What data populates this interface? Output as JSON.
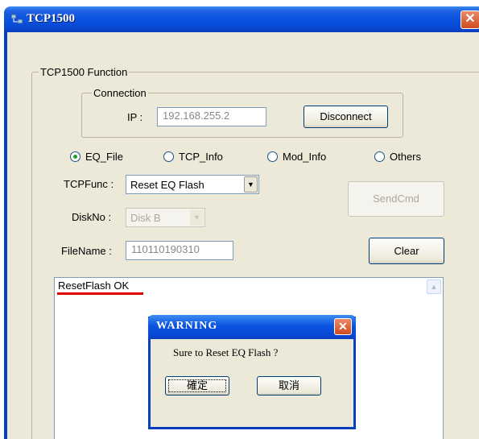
{
  "window": {
    "title": "TCP1500"
  },
  "function_group": {
    "label": "TCP1500 Function"
  },
  "connection": {
    "label": "Connection",
    "ip_label": "IP :",
    "ip_value": "192.168.255.2",
    "disconnect_label": "Disconnect"
  },
  "radios": [
    {
      "label": "EQ_File",
      "selected": true
    },
    {
      "label": "TCP_Info",
      "selected": false
    },
    {
      "label": "Mod_Info",
      "selected": false
    },
    {
      "label": "Others",
      "selected": false
    }
  ],
  "tcpfunc": {
    "label": "TCPFunc :",
    "value": "Reset EQ Flash"
  },
  "sendcmd_label": "SendCmd",
  "diskno": {
    "label": "DiskNo :",
    "value": "Disk B"
  },
  "filename": {
    "label": "FileName :",
    "value": "110110190310"
  },
  "clear_label": "Clear",
  "log": {
    "text": "ResetFlash OK"
  },
  "dialog": {
    "title": "WARNING",
    "message": "Sure to Reset EQ Flash ?",
    "ok_label": "確定",
    "cancel_label": "取消"
  },
  "colors": {
    "xp_blue": "#0a53e0",
    "underline_red": "#e00000",
    "close_red": "#d04b20"
  }
}
